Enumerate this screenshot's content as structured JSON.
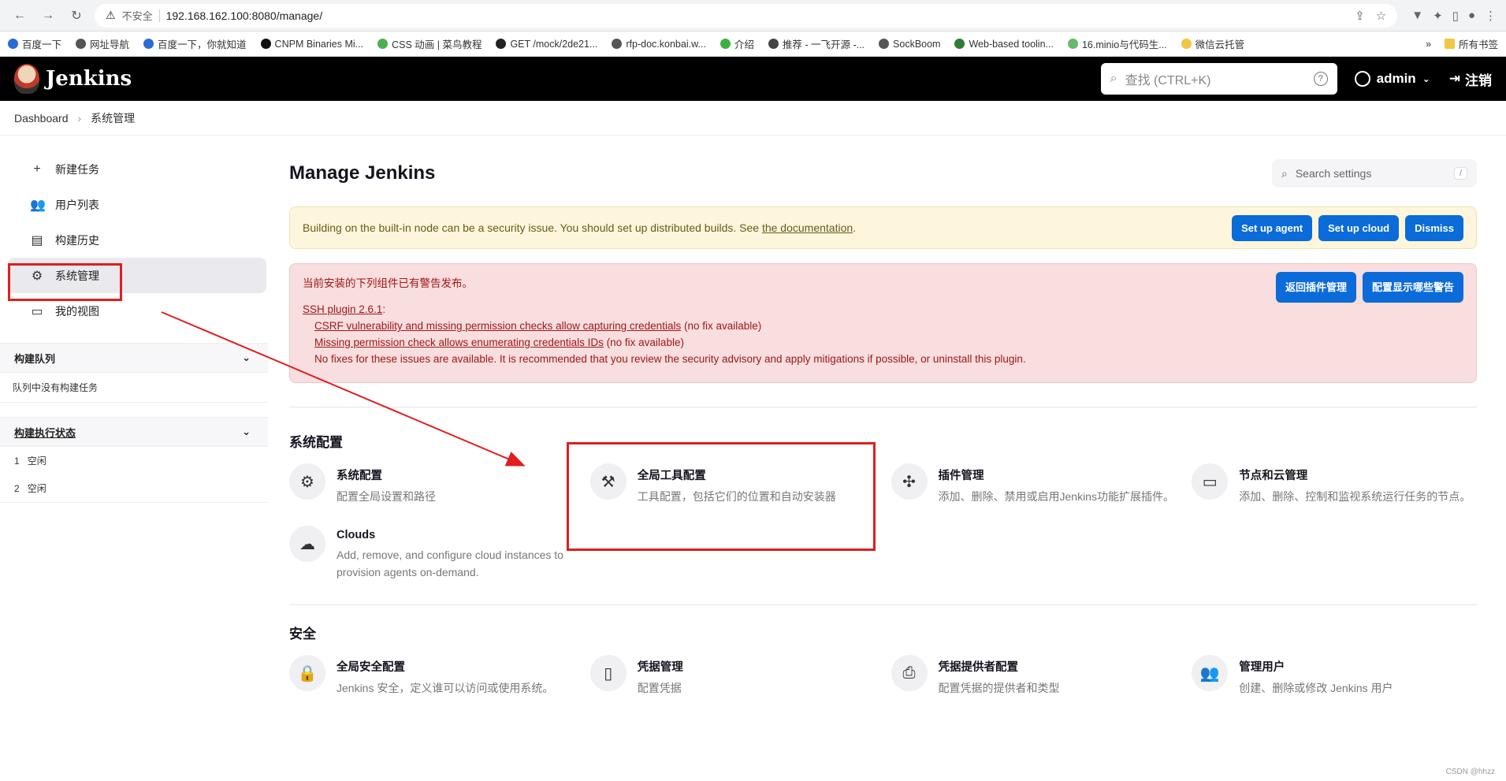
{
  "browser": {
    "insecure_label": "不安全",
    "url": "192.168.162.100:8080/manage/",
    "bookmarks": [
      "百度一下",
      "网址导航",
      "百度一下，你就知道",
      "CNPM Binaries Mi...",
      "CSS 动画 | 菜鸟教程",
      "GET /mock/2de21...",
      "rfp-doc.konbai.w...",
      "介绍",
      "推荐 - 一飞开源 -...",
      "SockBoom",
      "Web-based toolin...",
      "16.minio与代码生...",
      "微信云托管"
    ],
    "all_bookmarks": "所有书签"
  },
  "header": {
    "brand": "Jenkins",
    "search_placeholder": "查找 (CTRL+K)",
    "user": "admin",
    "logout": "注销"
  },
  "breadcrumb": {
    "root": "Dashboard",
    "current": "系统管理"
  },
  "sidebar": {
    "items": [
      {
        "icon": "plus-icon",
        "label": "新建任务"
      },
      {
        "icon": "users-icon",
        "label": "用户列表"
      },
      {
        "icon": "history-icon",
        "label": "构建历史"
      },
      {
        "icon": "gear-icon",
        "label": "系统管理"
      },
      {
        "icon": "window-icon",
        "label": "我的视图"
      }
    ],
    "queue_title": "构建队列",
    "queue_empty": "队列中没有构建任务",
    "executors_title": "构建执行状态",
    "executors": [
      {
        "num": "1",
        "status": "空闲"
      },
      {
        "num": "2",
        "status": "空闲"
      }
    ]
  },
  "main": {
    "title": "Manage Jenkins",
    "settings_search_placeholder": "Search settings",
    "settings_search_kbd": "/",
    "warn": {
      "text": "Building on the built-in node can be a security issue. You should set up distributed builds. See ",
      "link": "the documentation",
      "tail": ".",
      "buttons": [
        "Set up agent",
        "Set up cloud",
        "Dismiss"
      ]
    },
    "danger": {
      "intro": "当前安装的下列组件已有警告发布。",
      "plugin": "SSH plugin 2.6.1",
      "plugin_colon": ":",
      "vuln1": "CSRF vulnerability and missing permission checks allow capturing credentials",
      "vuln1_note": " (no fix available)",
      "vuln2": "Missing permission check allows enumerating credentials IDs",
      "vuln2_note": " (no fix available)",
      "nofix": "No fixes for these issues are available. It is recommended that you review the security advisory and apply mitigations if possible, or uninstall this plugin.",
      "buttons": [
        "返回插件管理",
        "配置显示哪些警告"
      ]
    },
    "sections": [
      {
        "title": "系统配置",
        "cards": [
          {
            "icon": "gear-icon",
            "title": "系统配置",
            "desc": "配置全局设置和路径"
          },
          {
            "icon": "hammer-icon",
            "title": "全局工具配置",
            "desc": "工具配置，包括它们的位置和自动安装器"
          },
          {
            "icon": "puzzle-icon",
            "title": "插件管理",
            "desc": "添加、删除、禁用或启用Jenkins功能扩展插件。"
          },
          {
            "icon": "monitor-icon",
            "title": "节点和云管理",
            "desc": "添加、删除、控制和监视系统运行任务的节点。"
          },
          {
            "icon": "cloud-icon",
            "title": "Clouds",
            "desc": "Add, remove, and configure cloud instances to provision agents on-demand."
          }
        ]
      },
      {
        "title": "安全",
        "cards": [
          {
            "icon": "lock-icon",
            "title": "全局安全配置",
            "desc": "Jenkins 安全，定义谁可以访问或使用系统。"
          },
          {
            "icon": "phone-icon",
            "title": "凭据管理",
            "desc": "配置凭据"
          },
          {
            "icon": "printer-icon",
            "title": "凭据提供者配置",
            "desc": "配置凭据的提供者和类型"
          },
          {
            "icon": "users-icon",
            "title": "管理用户",
            "desc": "创建、删除或修改 Jenkins 用户"
          }
        ]
      }
    ]
  },
  "watermark": "CSDN @hhzz",
  "colors": {
    "accent": "#0b6bd8",
    "annotation": "#e01e1e"
  }
}
